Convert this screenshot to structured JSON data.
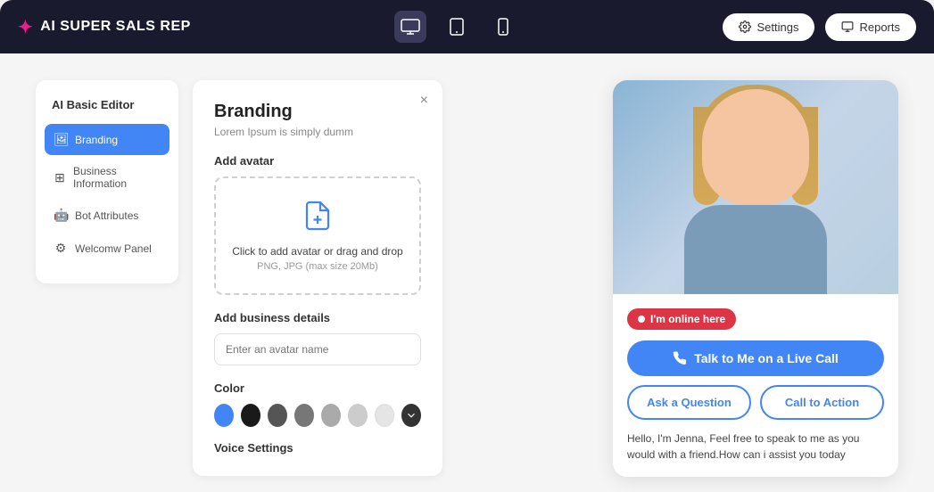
{
  "navbar": {
    "brand": "AI SUPER SALS REP",
    "settings_label": "Settings",
    "reports_label": "Reports"
  },
  "sidebar": {
    "title": "AI Basic Editor",
    "items": [
      {
        "id": "branding",
        "label": "Branding",
        "icon": "🖼",
        "active": true
      },
      {
        "id": "business-info",
        "label": "Business Information",
        "icon": "⊞",
        "active": false
      },
      {
        "id": "bot-attributes",
        "label": "Bot Attributes",
        "icon": "🤖",
        "active": false
      },
      {
        "id": "welcome-panel",
        "label": "Welcomw Panel",
        "icon": "⚙",
        "active": false
      }
    ]
  },
  "editor": {
    "title": "Branding",
    "subtitle": "Lorem Ipsum is simply dumm",
    "avatar_section_label": "Add avatar",
    "upload_text": "Click to add avatar or drag and drop",
    "upload_hint": "PNG, JPG (max size 20Mb)",
    "business_section_label": "Add business details",
    "input_placeholder": "Enter an avatar name",
    "color_section_label": "Color",
    "colors": [
      {
        "hex": "#4285f4",
        "label": "blue"
      },
      {
        "hex": "#1a1a1a",
        "label": "black"
      },
      {
        "hex": "#666666",
        "label": "dark-gray"
      },
      {
        "hex": "#888888",
        "label": "medium-gray"
      },
      {
        "hex": "#aaaaaa",
        "label": "light-gray"
      },
      {
        "hex": "#cccccc",
        "label": "lighter-gray"
      },
      {
        "hex": "#e0e0e0",
        "label": "very-light-gray"
      }
    ],
    "voice_label": "Voice Settings"
  },
  "chat_preview": {
    "online_badge": "I'm online here",
    "live_call_button": "Talk to Me on a Live Call",
    "ask_question_button": "Ask a Question",
    "call_to_action_button": "Call to Action",
    "greeting_text": "Hello, I'm Jenna, Feel free to speak to me as you would with a friend.How can i assist you today"
  }
}
